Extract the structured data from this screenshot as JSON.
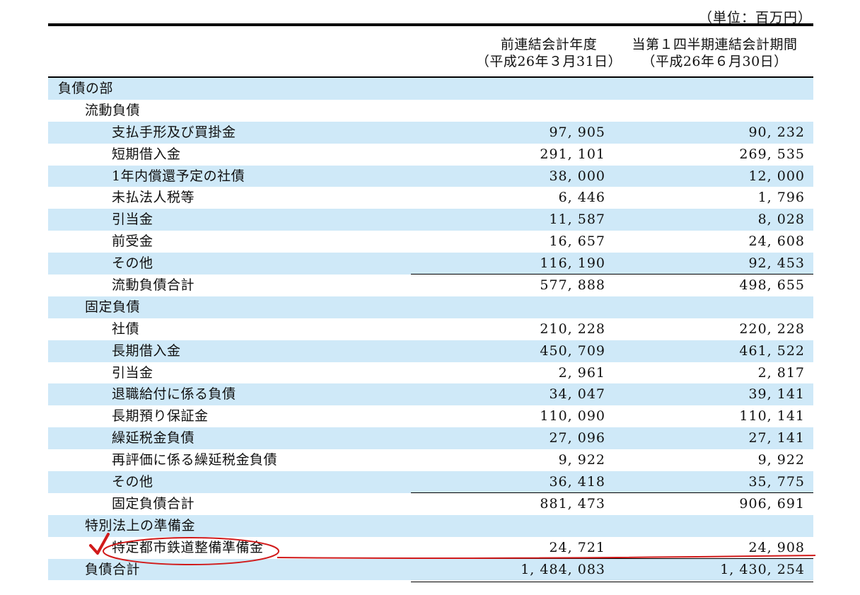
{
  "unit": "（単位：百万円）",
  "columns": {
    "prev": {
      "line1": "前連結会計年度",
      "line2": "（平成26年３月31日）"
    },
    "curr": {
      "line1": "当第１四半期連結会計期間",
      "line2": "（平成26年６月30日）"
    }
  },
  "rows": [
    {
      "label": "負債の部",
      "level": 0,
      "v1": "",
      "v2": ""
    },
    {
      "label": "流動負債",
      "level": 1,
      "v1": "",
      "v2": ""
    },
    {
      "label": "支払手形及び買掛金",
      "level": 2,
      "v1": "97, 905",
      "v2": "90, 232"
    },
    {
      "label": "短期借入金",
      "level": 2,
      "v1": "291, 101",
      "v2": "269, 535"
    },
    {
      "label": "1年内償還予定の社債",
      "level": 2,
      "v1": "38, 000",
      "v2": "12, 000"
    },
    {
      "label": "未払法人税等",
      "level": 2,
      "v1": "6, 446",
      "v2": "1, 796"
    },
    {
      "label": "引当金",
      "level": 2,
      "v1": "11, 587",
      "v2": "8, 028"
    },
    {
      "label": "前受金",
      "level": 2,
      "v1": "16, 657",
      "v2": "24, 608"
    },
    {
      "label": "その他",
      "level": 2,
      "v1": "116, 190",
      "v2": "92, 453"
    },
    {
      "label": "流動負債合計",
      "level": 2,
      "v1": "577, 888",
      "v2": "498, 655",
      "subtotal": true
    },
    {
      "label": "固定負債",
      "level": 1,
      "v1": "",
      "v2": ""
    },
    {
      "label": "社債",
      "level": 2,
      "v1": "210, 228",
      "v2": "220, 228"
    },
    {
      "label": "長期借入金",
      "level": 2,
      "v1": "450, 709",
      "v2": "461, 522"
    },
    {
      "label": "引当金",
      "level": 2,
      "v1": "2, 961",
      "v2": "2, 817"
    },
    {
      "label": "退職給付に係る負債",
      "level": 2,
      "v1": "34, 047",
      "v2": "39, 141"
    },
    {
      "label": "長期預り保証金",
      "level": 2,
      "v1": "110, 090",
      "v2": "110, 141"
    },
    {
      "label": "繰延税金負債",
      "level": 2,
      "v1": "27, 096",
      "v2": "27, 141"
    },
    {
      "label": "再評価に係る繰延税金負債",
      "level": 2,
      "v1": "9, 922",
      "v2": "9, 922"
    },
    {
      "label": "その他",
      "level": 2,
      "v1": "36, 418",
      "v2": "35, 775"
    },
    {
      "label": "固定負債合計",
      "level": 2,
      "v1": "881, 473",
      "v2": "906, 691",
      "subtotal": true
    },
    {
      "label": "特別法上の準備金",
      "level": 1,
      "v1": "",
      "v2": ""
    },
    {
      "label": "特定都市鉄道整備準備金",
      "level": 2,
      "v1": "24, 721",
      "v2": "24, 908"
    },
    {
      "label": "負債合計",
      "level": 1,
      "v1": "1, 484, 083",
      "v2": "1, 430, 254",
      "subtotal": true,
      "final": true
    }
  ],
  "colors": {
    "row_shade": "#cfe9f8",
    "annotation": "#d11a1a"
  }
}
